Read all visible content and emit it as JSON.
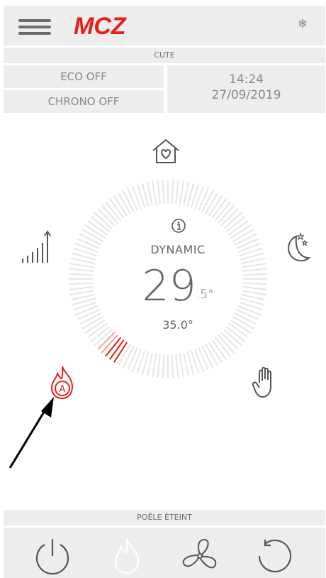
{
  "header": {
    "menu_icon": "hamburger-icon",
    "logo_text": "MCZ",
    "logo_color": "#e32119",
    "season_icon": "snowflake-icon",
    "season_glyph": "❄"
  },
  "device": {
    "name": "CUTE"
  },
  "status_panel": {
    "eco": "ECO OFF",
    "chrono": "CHRONO OFF",
    "time": "14:24",
    "date": "27/09/2019"
  },
  "thermostat": {
    "info_icon": "info-icon",
    "mode": "DYNAMIC",
    "temperature_int": "29",
    "temperature_dec": ".5°",
    "setpoint": "35.0°",
    "active_color": "#e32119"
  },
  "ring_icons": {
    "top": "home-heart-icon",
    "right": "moon-stars-icon",
    "bottom_right": "hand-icon",
    "bottom_left": "auto-flame-icon",
    "left": "power-level-icon"
  },
  "status_bar": {
    "text": "POÊLE ÉTEINT"
  },
  "bottom_bar": {
    "buttons": [
      "power-icon",
      "flame-icon",
      "fan-icon",
      "reset-icon"
    ]
  }
}
